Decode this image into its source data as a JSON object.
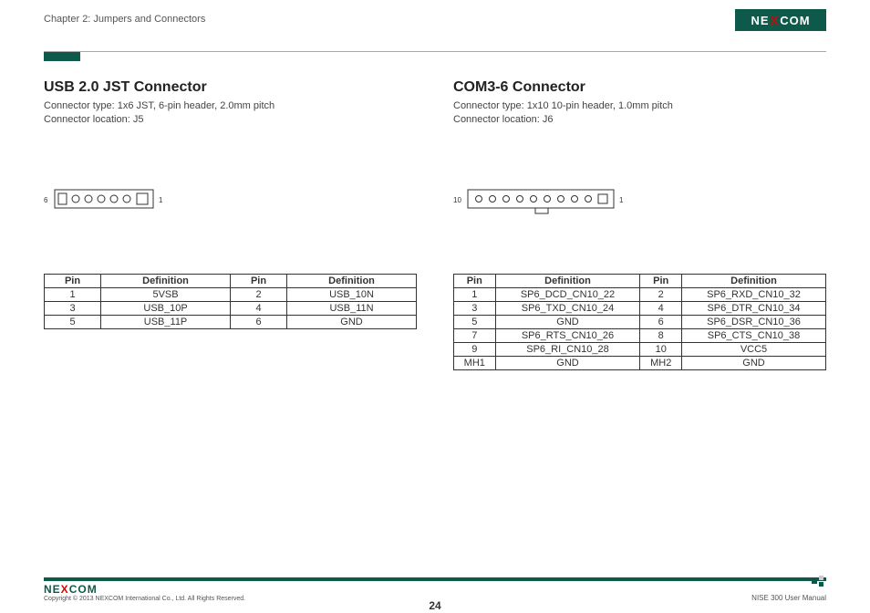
{
  "header": {
    "chapter": "Chapter 2: Jumpers and Connectors",
    "logo_pre": "NE",
    "logo_x": "X",
    "logo_post": "COM"
  },
  "left": {
    "title": "USB 2.0 JST Connector",
    "type_line": "Connector type: 1x6 JST, 6-pin header, 2.0mm pitch",
    "loc_line": "Connector location: J5",
    "label_left": "6",
    "label_right": "1",
    "table": {
      "headers": [
        "Pin",
        "Definition",
        "Pin",
        "Definition"
      ],
      "rows": [
        [
          "1",
          "5VSB",
          "2",
          "USB_10N"
        ],
        [
          "3",
          "USB_10P",
          "4",
          "USB_11N"
        ],
        [
          "5",
          "USB_11P",
          "6",
          "GND"
        ]
      ]
    }
  },
  "right": {
    "title": "COM3-6 Connector",
    "type_line": "Connector type: 1x10 10-pin header, 1.0mm pitch",
    "loc_line": "Connector location: J6",
    "label_left": "10",
    "label_right": "1",
    "table": {
      "headers": [
        "Pin",
        "Definition",
        "Pin",
        "Definition"
      ],
      "rows": [
        [
          "1",
          "SP6_DCD_CN10_22",
          "2",
          "SP6_RXD_CN10_32"
        ],
        [
          "3",
          "SP6_TXD_CN10_24",
          "4",
          "SP6_DTR_CN10_34"
        ],
        [
          "5",
          "GND",
          "6",
          "SP6_DSR_CN10_36"
        ],
        [
          "7",
          "SP6_RTS_CN10_26",
          "8",
          "SP6_CTS_CN10_38"
        ],
        [
          "9",
          "SP6_RI_CN10_28",
          "10",
          "VCC5"
        ],
        [
          "MH1",
          "GND",
          "MH2",
          "GND"
        ]
      ]
    }
  },
  "footer": {
    "logo_pre": "NE",
    "logo_x": "X",
    "logo_post": "COM",
    "copyright": "Copyright © 2013 NEXCOM International Co., Ltd. All Rights Reserved.",
    "page": "24",
    "manual": "NISE 300 User Manual"
  }
}
